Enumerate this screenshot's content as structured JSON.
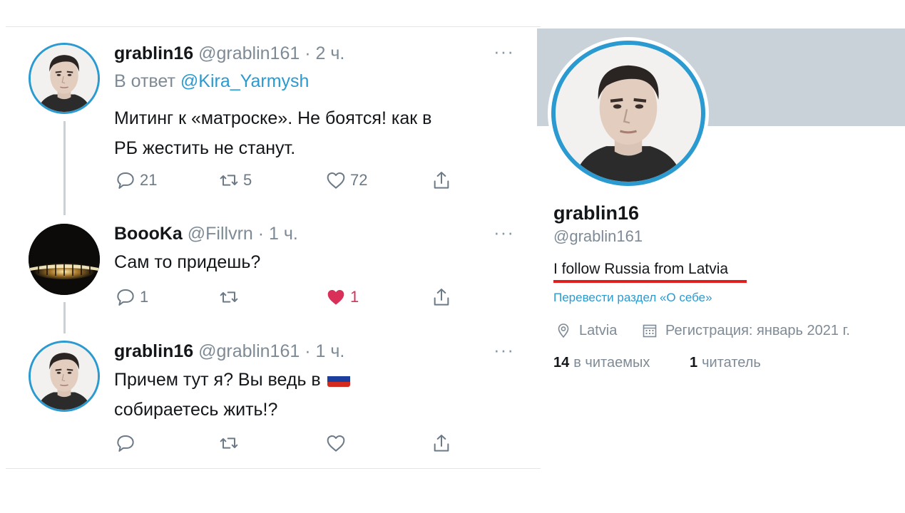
{
  "tweets": [
    {
      "name": "grablin16",
      "handle": "@grablin161",
      "time": "· 2 ч.",
      "reply_prefix": "В ответ",
      "reply_to": "@Kira_Yarmysh",
      "line1": "Митинг к «матроске». Не боятся! как в",
      "line2": "РБ жестить не станут.",
      "replies": "21",
      "retweets": "5",
      "likes": "72",
      "more": "···"
    },
    {
      "name": "BoooKa",
      "handle": "@Fillvrn",
      "time": "· 1 ч.",
      "line1": "Сам то придешь?",
      "replies": "1",
      "retweets": "",
      "likes": "1",
      "more": "···"
    },
    {
      "name": "grablin16",
      "handle": "@grablin161",
      "time": "· 1 ч.",
      "line1": "Причем тут я? Вы ведь в",
      "line2": "собираетесь жить!?",
      "flag_colors": [
        "#ffffff",
        "#1c3f9e",
        "#d52b1e"
      ],
      "replies": "",
      "retweets": "",
      "likes": "",
      "more": "···"
    }
  ],
  "profile": {
    "name": "grablin16",
    "handle": "@grablin161",
    "bio": "I follow Russia from Latvia",
    "translate": "Перевести раздел «О себе»",
    "location": "Latvia",
    "joined": "Регистрация: январь 2021 г.",
    "following_count": "14",
    "following_label": "в читаемых",
    "followers_count": "1",
    "followers_label": "читатель"
  },
  "colors": {
    "accent": "#2a9ad0",
    "muted": "#7e8b96",
    "like": "#d9305a",
    "underline": "#e01e1e",
    "banner": "#c9d2d8"
  },
  "icons": [
    "reply-icon",
    "retweet-icon",
    "like-icon",
    "share-icon",
    "more-icon",
    "location-icon",
    "calendar-icon"
  ]
}
